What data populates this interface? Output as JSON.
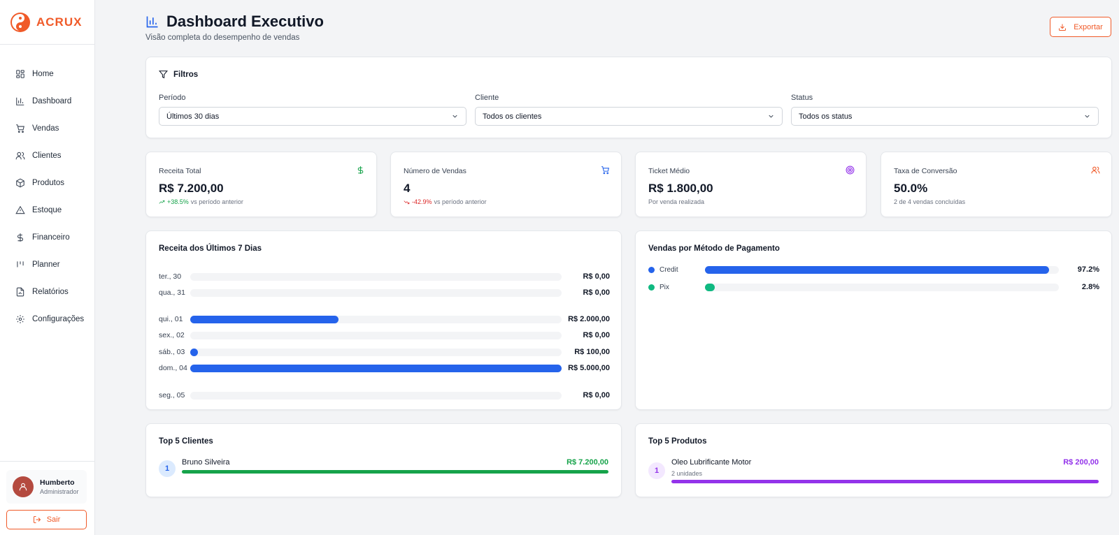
{
  "brand": {
    "name": "ACRUX",
    "color": "#f05a28"
  },
  "sidebar": {
    "items": [
      {
        "label": "Home",
        "icon": "grid-icon"
      },
      {
        "label": "Dashboard",
        "icon": "bar-chart-icon"
      },
      {
        "label": "Vendas",
        "icon": "cart-icon"
      },
      {
        "label": "Clientes",
        "icon": "users-icon"
      },
      {
        "label": "Produtos",
        "icon": "box-icon"
      },
      {
        "label": "Estoque",
        "icon": "warning-icon"
      },
      {
        "label": "Financeiro",
        "icon": "dollar-icon"
      },
      {
        "label": "Planner",
        "icon": "kanban-icon"
      },
      {
        "label": "Relatórios",
        "icon": "report-icon"
      },
      {
        "label": "Configurações",
        "icon": "gear-icon"
      }
    ],
    "user": {
      "name": "Humberto",
      "role": "Administrador"
    },
    "logout_label": "Sair"
  },
  "header": {
    "title": "Dashboard Executivo",
    "subtitle": "Visão completa do desempenho de vendas",
    "export_label": "Exportar"
  },
  "filters": {
    "title": "Filtros",
    "periodo": {
      "label": "Período",
      "value": "Últimos 30 dias"
    },
    "cliente": {
      "label": "Cliente",
      "value": "Todos os clientes"
    },
    "status": {
      "label": "Status",
      "value": "Todos os status"
    }
  },
  "kpis": {
    "receita": {
      "label": "Receita Total",
      "value": "R$ 7.200,00",
      "change": "+38.5%",
      "note": "vs período anterior",
      "color": "#16a34a"
    },
    "vendas": {
      "label": "Número de Vendas",
      "value": "4",
      "change": "-42.9%",
      "note": "vs período anterior",
      "color": "#2563eb"
    },
    "ticket": {
      "label": "Ticket Médio",
      "value": "R$ 1.800,00",
      "note": "Por venda realizada",
      "color": "#9333ea"
    },
    "conversao": {
      "label": "Taxa de Conversão",
      "value": "50.0%",
      "note": "2 de 4 vendas concluídas",
      "color": "#f05a28"
    }
  },
  "revenue": {
    "title": "Receita dos Últimos 7 Dias",
    "max": 5000,
    "rows": [
      {
        "label": "ter., 30",
        "value": 0,
        "amount": "R$ 0,00"
      },
      {
        "label": "qua., 31",
        "value": 0,
        "amount": "R$ 0,00"
      },
      {
        "label": "qui., 01",
        "value": 2000,
        "amount": "R$ 2.000,00"
      },
      {
        "label": "sex., 02",
        "value": 0,
        "amount": "R$ 0,00"
      },
      {
        "label": "sáb., 03",
        "value": 100,
        "amount": "R$ 100,00"
      },
      {
        "label": "dom., 04",
        "value": 5000,
        "amount": "R$ 5.000,00"
      },
      {
        "label": "seg., 05",
        "value": 0,
        "amount": "R$ 0,00"
      }
    ]
  },
  "payment": {
    "title": "Vendas por Método de Pagamento",
    "rows": [
      {
        "name": "Credit",
        "pct": 97.2,
        "pct_label": "97.2%",
        "color": "#2563eb"
      },
      {
        "name": "Pix",
        "pct": 2.8,
        "pct_label": "2.8%",
        "color": "#10b981"
      }
    ]
  },
  "top_clients": {
    "title": "Top 5 Clientes",
    "items": [
      {
        "rank": "1",
        "name": "Bruno Silveira",
        "value": "R$ 7.200,00"
      }
    ],
    "color": "#16a34a"
  },
  "top_products": {
    "title": "Top 5 Produtos",
    "items": [
      {
        "rank": "1",
        "name": "Oleo Lubrificante Motor",
        "sub": "2 unidades",
        "value": "R$ 200,00"
      }
    ],
    "color": "#9333ea"
  }
}
